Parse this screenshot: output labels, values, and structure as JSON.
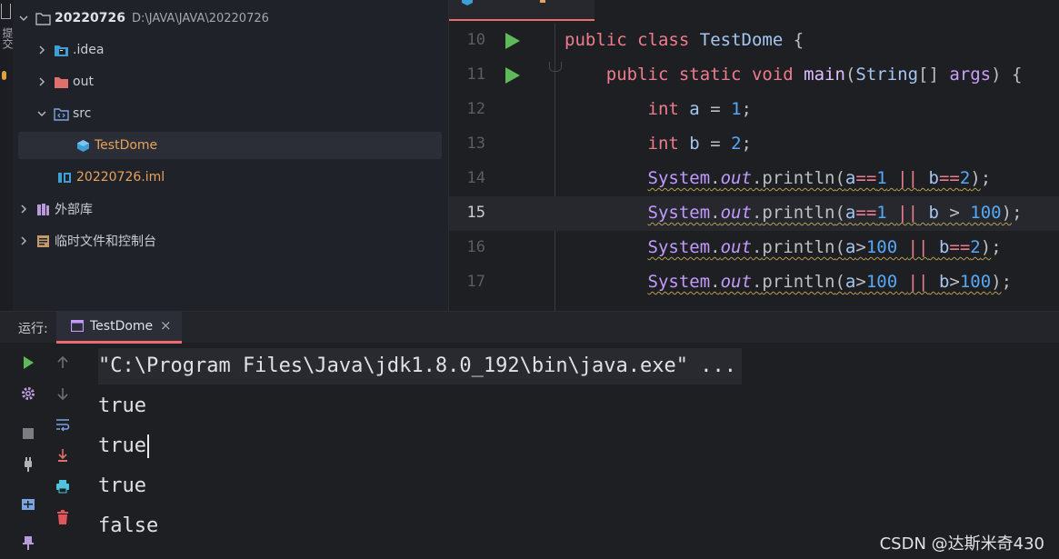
{
  "tool_strip": {
    "vertical_label": "提交"
  },
  "project": {
    "root": {
      "name": "20220726",
      "path": "D:\\JAVA\\JAVA\\20220726"
    },
    "items": [
      {
        "label": ".idea"
      },
      {
        "label": "out"
      },
      {
        "label": "src"
      },
      {
        "label": "TestDome"
      },
      {
        "label": "20220726.iml"
      },
      {
        "label": "外部库"
      },
      {
        "label": "临时文件和控制台"
      }
    ]
  },
  "editor": {
    "lines": [
      {
        "number": "10"
      },
      {
        "number": "11"
      },
      {
        "number": "12"
      },
      {
        "number": "13"
      },
      {
        "number": "14"
      },
      {
        "number": "15"
      },
      {
        "number": "16"
      },
      {
        "number": "17"
      }
    ],
    "code": {
      "public": "public",
      "class": "class",
      "static": "static",
      "void": "void",
      "int": "int",
      "class_name": "TestDome",
      "main": "main",
      "string_type": "String",
      "args": "args",
      "system": "System",
      "out": "out",
      "println": "println",
      "var_a": "a",
      "var_b": "b",
      "one": "1",
      "two": "2",
      "hundred": "100"
    }
  },
  "run": {
    "label": "运行:",
    "tab_label": "TestDome",
    "close_glyph": "×",
    "command": "\"C:\\Program Files\\Java\\jdk1.8.0_192\\bin\\java.exe\" ...",
    "output": [
      "true",
      "true",
      "true",
      "false"
    ]
  },
  "watermark": "CSDN @达斯米奇430",
  "colors": {
    "accent_red": "#ef6b6b",
    "run_green": "#5fb85a",
    "keyword": "#ef7c8e",
    "number": "#56a8f5",
    "file_orange": "#e8a25a"
  }
}
